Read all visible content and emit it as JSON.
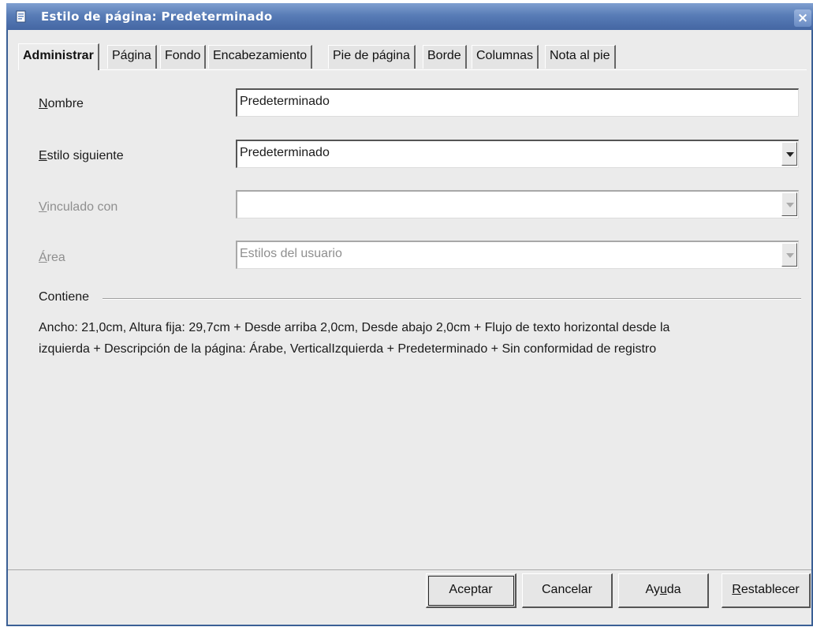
{
  "window": {
    "title": "Estilo de página: Predeterminado",
    "close_glyph": "×"
  },
  "tabs": [
    {
      "label": "Administrar",
      "active": true
    },
    {
      "label": "Página"
    },
    {
      "label": "Fondo"
    },
    {
      "label": "Encabezamiento"
    },
    {
      "label": "Pie de página"
    },
    {
      "label": "Borde"
    },
    {
      "label": "Columnas"
    },
    {
      "label": "Nota al pie"
    }
  ],
  "form": {
    "name": {
      "label_accel": "N",
      "label_rest": "ombre",
      "value": "Predeterminado"
    },
    "next_style": {
      "label_accel": "E",
      "label_rest": "stilo siguiente",
      "value": "Predeterminado"
    },
    "linked_with": {
      "label_accel": "V",
      "label_rest": "inculado con",
      "value": ""
    },
    "area": {
      "label_accel": "Á",
      "label_rest": "rea",
      "value": "Estilos del usuario"
    }
  },
  "contains": {
    "label": "Contiene",
    "line1": "Ancho: 21,0cm, Altura fija: 29,7cm + Desde arriba 2,0cm, Desde abajo 2,0cm + Flujo de texto horizontal desde la",
    "line2": "izquierda + Descripción de la página:  Árabe, VerticalIzquierda + Predeterminado + Sin conformidad de registro"
  },
  "buttons": {
    "ok": "Aceptar",
    "cancel": "Cancelar",
    "help_pre": "Ay",
    "help_accel": "u",
    "help_post": "da",
    "reset_accel": "R",
    "reset_rest": "establecer"
  },
  "icons": {
    "title": "page-style-icon",
    "close": "close-icon",
    "dropdown": "chevron-down-icon"
  }
}
